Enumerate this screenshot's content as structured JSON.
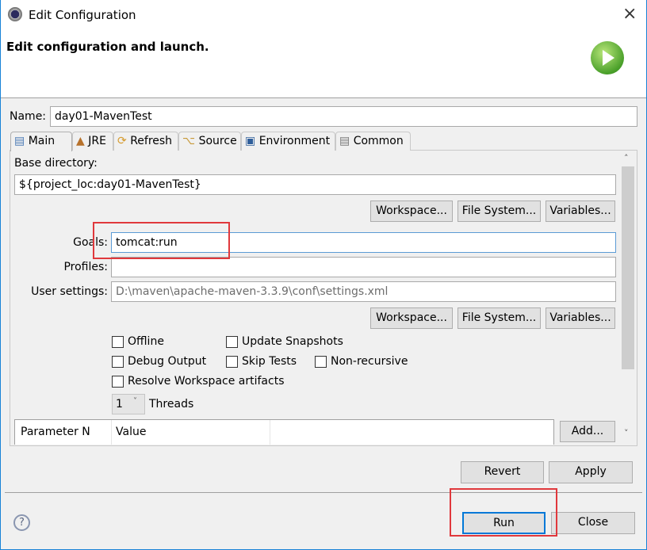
{
  "window": {
    "title": "Edit Configuration",
    "close_icon": "×"
  },
  "header": {
    "title": "Edit configuration and launch.",
    "icon": "run-play-icon"
  },
  "name": {
    "label": "Name:",
    "value": "day01-MavenTest"
  },
  "tabs": [
    {
      "label": "Main",
      "icon": "main-icon"
    },
    {
      "label": "JRE",
      "icon": "jre-icon"
    },
    {
      "label": "Refresh",
      "icon": "refresh-icon"
    },
    {
      "label": "Source",
      "icon": "source-icon"
    },
    {
      "label": "Environment",
      "icon": "environment-icon"
    },
    {
      "label": "Common",
      "icon": "common-icon"
    }
  ],
  "main": {
    "base_dir_label": "Base directory:",
    "base_dir_value": "${project_loc:day01-MavenTest}",
    "workspace_btn": "Workspace...",
    "filesystem_btn": "File System...",
    "variables_btn": "Variables...",
    "goals_label": "Goals:",
    "goals_value": "tomcat:run",
    "profiles_label": "Profiles:",
    "profiles_value": "",
    "user_settings_label": "User settings:",
    "user_settings_value": "D:\\maven\\apache-maven-3.3.9\\conf\\settings.xml",
    "checkboxes": {
      "offline": "Offline",
      "update_snapshots": "Update Snapshots",
      "debug_output": "Debug Output",
      "skip_tests": "Skip Tests",
      "non_recursive": "Non-recursive",
      "resolve_workspace": "Resolve Workspace artifacts"
    },
    "threads_value": "1",
    "threads_label": "Threads",
    "table_headers": [
      "Parameter N",
      "Value"
    ],
    "add_btn": "Add..."
  },
  "footer": {
    "revert": "Revert",
    "apply": "Apply",
    "run": "Run",
    "close": "Close",
    "help": "?"
  }
}
